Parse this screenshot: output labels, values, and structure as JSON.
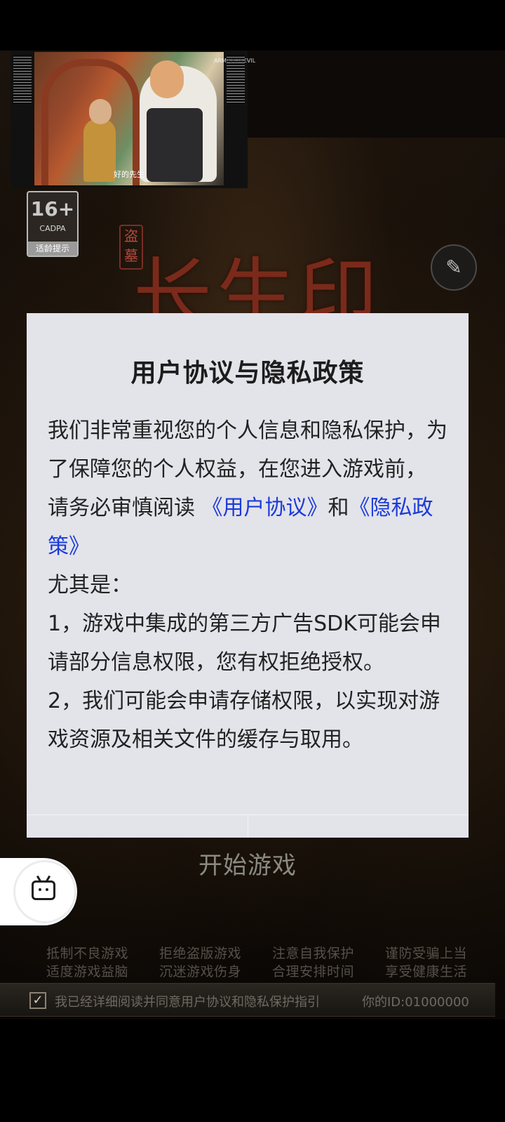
{
  "video": {
    "subtitle": "好的先生",
    "watermark": "ARMOURDEVIL"
  },
  "age_badge": {
    "rating": "16+",
    "org": "CADPA",
    "tip": "适龄提示"
  },
  "game_title": {
    "seal": "盗墓",
    "title": "长生印"
  },
  "dialog": {
    "title": "用户协议与隐私政策",
    "p1": "我们非常重视您的个人信息和隐私保护，为了保障您的个人权益，在您进入游戏前，",
    "p2_prefix": "请务必审慎阅读",
    "user_agreement_link": "《用户协议》",
    "and": "和",
    "privacy_policy_link": "《隐私政策》",
    "especially": "尤其是：",
    "item1": "1，游戏中集成的第三方广告SDK可能会申请部分信息权限，您有权拒绝授权。",
    "item2": "2，我们可能会申请存储权限，以实现对游戏资源及相关文件的缓存与取用。"
  },
  "start_game": "开始游戏",
  "health_advice": {
    "row1": [
      "抵制不良游戏",
      "拒绝盗版游戏",
      "注意自我保护",
      "谨防受骗上当"
    ],
    "row2": [
      "适度游戏益脑",
      "沉迷游戏伤身",
      "合理安排时间",
      "享受健康生活"
    ]
  },
  "agreement": {
    "check": "✓",
    "text": "我已经详细阅读并同意用户协议和隐私保护指引",
    "id_text": "你的ID:01000000"
  },
  "icons": {
    "menu": "notepad-icon",
    "floating": "bilibili-tv-icon"
  }
}
